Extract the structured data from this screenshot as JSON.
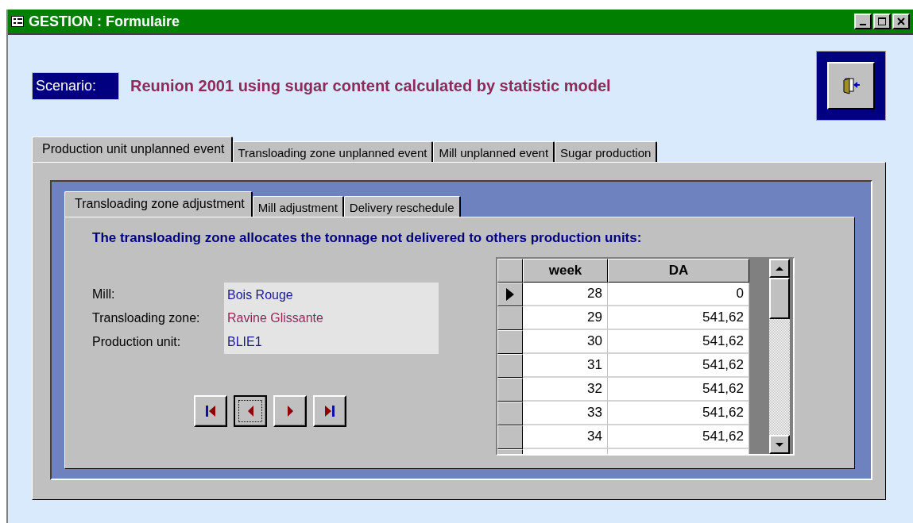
{
  "window": {
    "title": "GESTION : Formulaire"
  },
  "scenario": {
    "label": "Scenario:",
    "value": "Reunion 2001 using sugar content calculated by statistic model"
  },
  "tabs": [
    {
      "label": "Production unit unplanned event",
      "selected": true
    },
    {
      "label": "Transloading zone unplanned event",
      "selected": false
    },
    {
      "label": "Mill unplanned event",
      "selected": false
    },
    {
      "label": "Sugar production",
      "selected": false
    }
  ],
  "subtabs": [
    {
      "label": "Transloading zone adjustment",
      "selected": true
    },
    {
      "label": "Mill adjustment",
      "selected": false
    },
    {
      "label": "Delivery reschedule",
      "selected": false
    }
  ],
  "heading": "The transloading zone allocates the tonnage not delivered to others production units:",
  "fields": [
    {
      "label": "Mill:",
      "value": "Bois Rouge",
      "color": "#1a1a8c"
    },
    {
      "label": "Transloading zone:",
      "value": "Ravine Glissante",
      "color": "#8c2a5a"
    },
    {
      "label": "Production unit:",
      "value": "BLIE1",
      "color": "#1a1a8c"
    }
  ],
  "navigation": [
    {
      "kind": "first",
      "focused": false
    },
    {
      "kind": "previous",
      "focused": true
    },
    {
      "kind": "next",
      "focused": false
    },
    {
      "kind": "last",
      "focused": false
    }
  ],
  "table": {
    "columns": [
      "week",
      "DA"
    ],
    "rows": [
      {
        "cells": [
          "28",
          "0"
        ],
        "selected": true
      },
      {
        "cells": [
          "29",
          "541,62"
        ],
        "selected": false
      },
      {
        "cells": [
          "30",
          "541,62"
        ],
        "selected": false
      },
      {
        "cells": [
          "31",
          "541,62"
        ],
        "selected": false
      },
      {
        "cells": [
          "32",
          "541,62"
        ],
        "selected": false
      },
      {
        "cells": [
          "33",
          "541,62"
        ],
        "selected": false
      },
      {
        "cells": [
          "34",
          "541,62"
        ],
        "selected": false
      }
    ]
  }
}
